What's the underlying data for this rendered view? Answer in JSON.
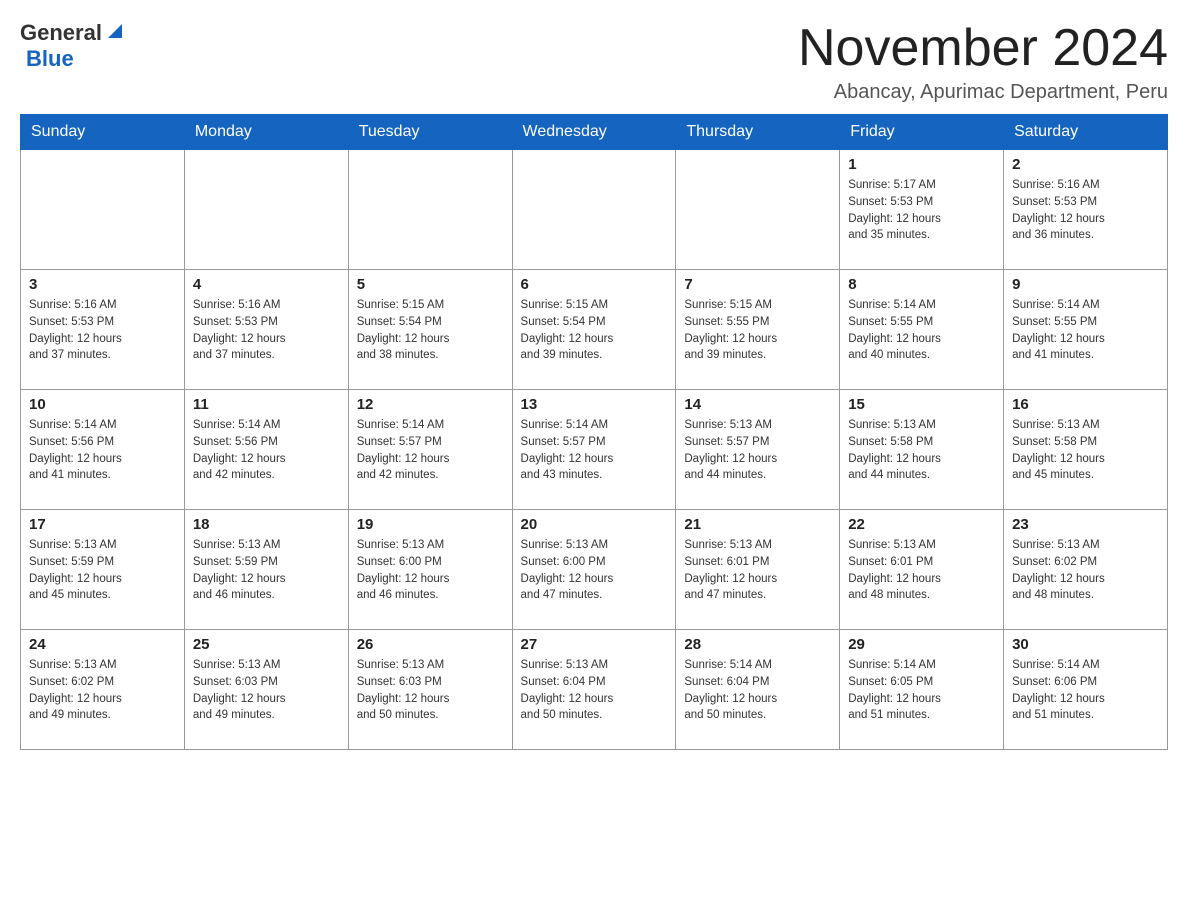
{
  "header": {
    "logo": {
      "general": "General",
      "blue": "Blue",
      "tagline": "Abancay, Apurimac Department, Peru"
    },
    "title": "November 2024",
    "subtitle": "Abancay, Apurimac Department, Peru"
  },
  "days_of_week": [
    "Sunday",
    "Monday",
    "Tuesday",
    "Wednesday",
    "Thursday",
    "Friday",
    "Saturday"
  ],
  "weeks": [
    {
      "cells": [
        {
          "day": "",
          "info": ""
        },
        {
          "day": "",
          "info": ""
        },
        {
          "day": "",
          "info": ""
        },
        {
          "day": "",
          "info": ""
        },
        {
          "day": "",
          "info": ""
        },
        {
          "day": "1",
          "info": "Sunrise: 5:17 AM\nSunset: 5:53 PM\nDaylight: 12 hours\nand 35 minutes."
        },
        {
          "day": "2",
          "info": "Sunrise: 5:16 AM\nSunset: 5:53 PM\nDaylight: 12 hours\nand 36 minutes."
        }
      ]
    },
    {
      "cells": [
        {
          "day": "3",
          "info": "Sunrise: 5:16 AM\nSunset: 5:53 PM\nDaylight: 12 hours\nand 37 minutes."
        },
        {
          "day": "4",
          "info": "Sunrise: 5:16 AM\nSunset: 5:53 PM\nDaylight: 12 hours\nand 37 minutes."
        },
        {
          "day": "5",
          "info": "Sunrise: 5:15 AM\nSunset: 5:54 PM\nDaylight: 12 hours\nand 38 minutes."
        },
        {
          "day": "6",
          "info": "Sunrise: 5:15 AM\nSunset: 5:54 PM\nDaylight: 12 hours\nand 39 minutes."
        },
        {
          "day": "7",
          "info": "Sunrise: 5:15 AM\nSunset: 5:55 PM\nDaylight: 12 hours\nand 39 minutes."
        },
        {
          "day": "8",
          "info": "Sunrise: 5:14 AM\nSunset: 5:55 PM\nDaylight: 12 hours\nand 40 minutes."
        },
        {
          "day": "9",
          "info": "Sunrise: 5:14 AM\nSunset: 5:55 PM\nDaylight: 12 hours\nand 41 minutes."
        }
      ]
    },
    {
      "cells": [
        {
          "day": "10",
          "info": "Sunrise: 5:14 AM\nSunset: 5:56 PM\nDaylight: 12 hours\nand 41 minutes."
        },
        {
          "day": "11",
          "info": "Sunrise: 5:14 AM\nSunset: 5:56 PM\nDaylight: 12 hours\nand 42 minutes."
        },
        {
          "day": "12",
          "info": "Sunrise: 5:14 AM\nSunset: 5:57 PM\nDaylight: 12 hours\nand 42 minutes."
        },
        {
          "day": "13",
          "info": "Sunrise: 5:14 AM\nSunset: 5:57 PM\nDaylight: 12 hours\nand 43 minutes."
        },
        {
          "day": "14",
          "info": "Sunrise: 5:13 AM\nSunset: 5:57 PM\nDaylight: 12 hours\nand 44 minutes."
        },
        {
          "day": "15",
          "info": "Sunrise: 5:13 AM\nSunset: 5:58 PM\nDaylight: 12 hours\nand 44 minutes."
        },
        {
          "day": "16",
          "info": "Sunrise: 5:13 AM\nSunset: 5:58 PM\nDaylight: 12 hours\nand 45 minutes."
        }
      ]
    },
    {
      "cells": [
        {
          "day": "17",
          "info": "Sunrise: 5:13 AM\nSunset: 5:59 PM\nDaylight: 12 hours\nand 45 minutes."
        },
        {
          "day": "18",
          "info": "Sunrise: 5:13 AM\nSunset: 5:59 PM\nDaylight: 12 hours\nand 46 minutes."
        },
        {
          "day": "19",
          "info": "Sunrise: 5:13 AM\nSunset: 6:00 PM\nDaylight: 12 hours\nand 46 minutes."
        },
        {
          "day": "20",
          "info": "Sunrise: 5:13 AM\nSunset: 6:00 PM\nDaylight: 12 hours\nand 47 minutes."
        },
        {
          "day": "21",
          "info": "Sunrise: 5:13 AM\nSunset: 6:01 PM\nDaylight: 12 hours\nand 47 minutes."
        },
        {
          "day": "22",
          "info": "Sunrise: 5:13 AM\nSunset: 6:01 PM\nDaylight: 12 hours\nand 48 minutes."
        },
        {
          "day": "23",
          "info": "Sunrise: 5:13 AM\nSunset: 6:02 PM\nDaylight: 12 hours\nand 48 minutes."
        }
      ]
    },
    {
      "cells": [
        {
          "day": "24",
          "info": "Sunrise: 5:13 AM\nSunset: 6:02 PM\nDaylight: 12 hours\nand 49 minutes."
        },
        {
          "day": "25",
          "info": "Sunrise: 5:13 AM\nSunset: 6:03 PM\nDaylight: 12 hours\nand 49 minutes."
        },
        {
          "day": "26",
          "info": "Sunrise: 5:13 AM\nSunset: 6:03 PM\nDaylight: 12 hours\nand 50 minutes."
        },
        {
          "day": "27",
          "info": "Sunrise: 5:13 AM\nSunset: 6:04 PM\nDaylight: 12 hours\nand 50 minutes."
        },
        {
          "day": "28",
          "info": "Sunrise: 5:14 AM\nSunset: 6:04 PM\nDaylight: 12 hours\nand 50 minutes."
        },
        {
          "day": "29",
          "info": "Sunrise: 5:14 AM\nSunset: 6:05 PM\nDaylight: 12 hours\nand 51 minutes."
        },
        {
          "day": "30",
          "info": "Sunrise: 5:14 AM\nSunset: 6:06 PM\nDaylight: 12 hours\nand 51 minutes."
        }
      ]
    }
  ]
}
